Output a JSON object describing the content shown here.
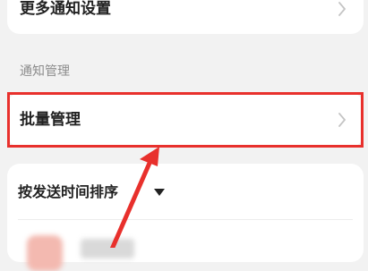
{
  "more_notifications": {
    "label": "更多通知设置",
    "icon": "chevron-right-icon"
  },
  "notification_management": {
    "section_title": "通知管理",
    "batch_manage": {
      "label": "批量管理",
      "icon": "chevron-right-icon"
    }
  },
  "sort": {
    "label": "按发送时间排序",
    "icon": "caret-down-icon"
  },
  "annotation": {
    "highlight_color": "#e8302c",
    "arrow_color": "#e8302c"
  }
}
